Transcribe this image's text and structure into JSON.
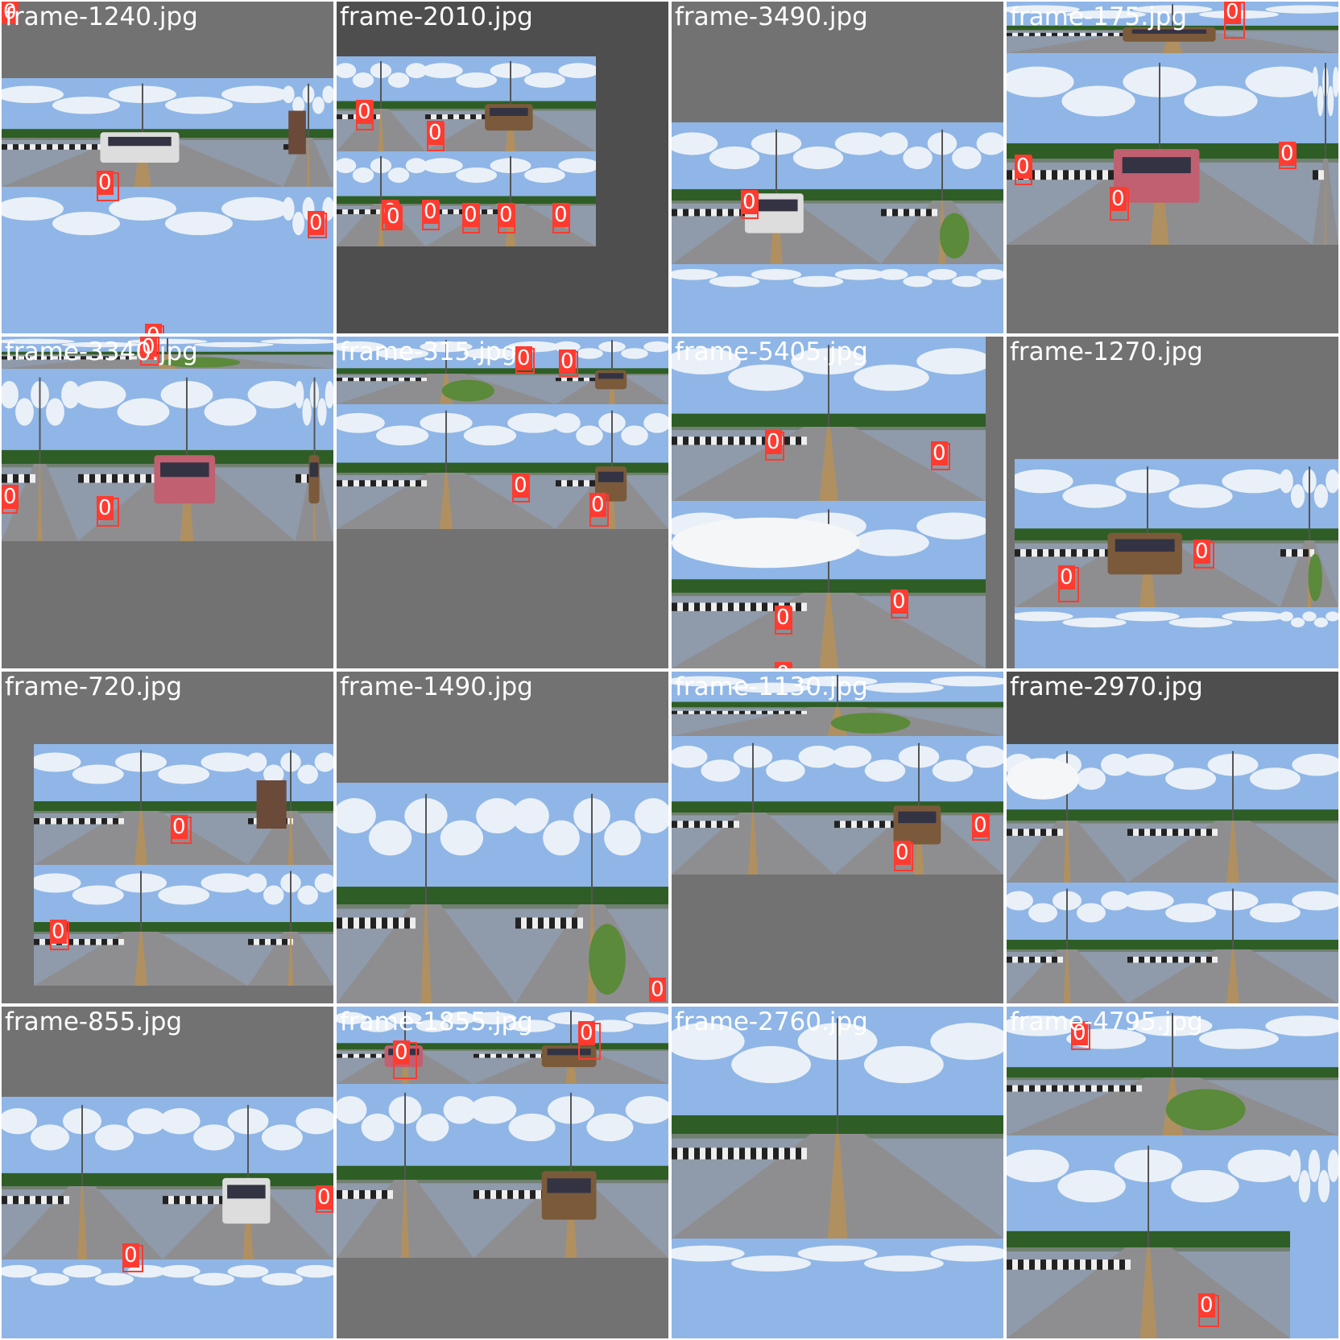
{
  "colors": {
    "frame_bg_light": "#727272",
    "frame_bg_dark": "#4e4e4e",
    "detection": "#ff3b30",
    "sky": "#8fb6e6",
    "cloud": "#f4f6f8",
    "road": "#8e8e90",
    "trees": "#2e5e25",
    "barrier_dark": "#222222",
    "barrier_light": "#eeeeee",
    "median_sign": "#5a8a3a"
  },
  "grid": {
    "tiles": [
      {
        "name": "frame-1240.jpg",
        "tone": "light",
        "detections": [
          "0",
          "0",
          "0",
          "0"
        ]
      },
      {
        "name": "frame-2010.jpg",
        "tone": "dark",
        "detections": [
          "0",
          "0",
          "0",
          "0",
          "0",
          "0",
          "0",
          "0"
        ]
      },
      {
        "name": "frame-3490.jpg",
        "tone": "light",
        "detections": [
          "0"
        ]
      },
      {
        "name": "frame-175.jpg",
        "tone": "light",
        "detections": [
          "0",
          "0",
          "0",
          "0"
        ]
      },
      {
        "name": "frame-3340.jpg",
        "tone": "light",
        "detections": [
          "0",
          "0",
          "0"
        ]
      },
      {
        "name": "frame-315.jpg",
        "tone": "light",
        "detections": [
          "0",
          "0",
          "0",
          "0"
        ]
      },
      {
        "name": "frame-5405.jpg",
        "tone": "light",
        "detections": [
          "0",
          "0",
          "0",
          "0",
          "0"
        ]
      },
      {
        "name": "frame-1270.jpg",
        "tone": "light",
        "detections": [
          "0",
          "0"
        ]
      },
      {
        "name": "frame-720.jpg",
        "tone": "light",
        "detections": [
          "0",
          "0"
        ]
      },
      {
        "name": "frame-1490.jpg",
        "tone": "light",
        "detections": [
          "0"
        ]
      },
      {
        "name": "frame-1130.jpg",
        "tone": "light",
        "detections": [
          "0",
          "0"
        ]
      },
      {
        "name": "frame-2970.jpg",
        "tone": "dark",
        "detections": []
      },
      {
        "name": "frame-855.jpg",
        "tone": "light",
        "detections": [
          "0",
          "0"
        ]
      },
      {
        "name": "frame-1855.jpg",
        "tone": "light",
        "detections": [
          "0",
          "0"
        ]
      },
      {
        "name": "frame-2760.jpg",
        "tone": "light",
        "detections": []
      },
      {
        "name": "frame-4795.jpg",
        "tone": "light",
        "detections": [
          "0",
          "0"
        ]
      }
    ]
  }
}
